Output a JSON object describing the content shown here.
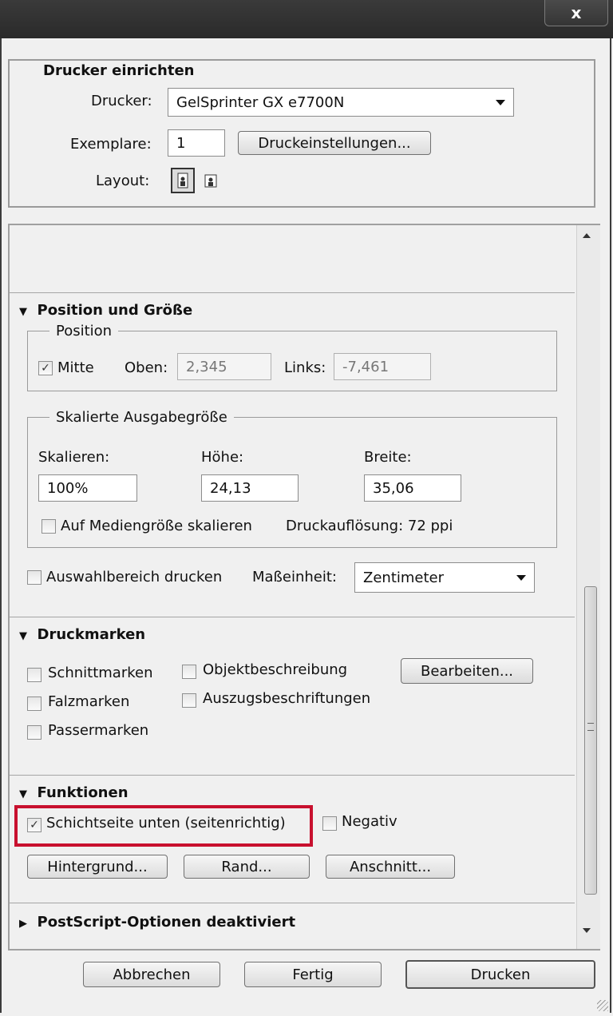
{
  "window": {
    "close_glyph": "x"
  },
  "setup": {
    "title": "Drucker einrichten",
    "printer_label": "Drucker:",
    "printer_value": "GelSprinter GX e7700N",
    "copies_label": "Exemplare:",
    "copies_value": "1",
    "settings_button": "Druckeinstellungen...",
    "layout_label": "Layout:"
  },
  "position_size": {
    "header": "Position und Größe",
    "position_group": "Position",
    "center_label": "Mitte",
    "center_checked": true,
    "top_label": "Oben:",
    "top_value": "2,345",
    "left_label": "Links:",
    "left_value": "-7,461",
    "scaled_group": "Skalierte Ausgabegröße",
    "scale_label": "Skalieren:",
    "scale_value": "100%",
    "height_label": "Höhe:",
    "height_value": "24,13",
    "width_label": "Breite:",
    "width_value": "35,06",
    "fit_media_label": "Auf Mediengröße skalieren",
    "resolution_text": "Druckauflösung: 72 ppi",
    "print_selection_label": "Auswahlbereich drucken",
    "unit_label": "Maßeinheit:",
    "unit_value": "Zentimeter"
  },
  "marks": {
    "header": "Druckmarken",
    "crop_marks": "Schnittmarken",
    "object_desc": "Objektbeschreibung",
    "edit_button": "Bearbeiten...",
    "fold_marks": "Falzmarken",
    "separation_labels": "Auszugsbeschriftungen",
    "registration_marks": "Passermarken"
  },
  "functions": {
    "header": "Funktionen",
    "emulsion_down": "Schichtseite unten (seitenrichtig)",
    "emulsion_checked": true,
    "negative": "Negativ",
    "background_button": "Hintergrund...",
    "border_button": "Rand...",
    "bleed_button": "Anschnitt..."
  },
  "postscript": {
    "header": "PostScript-Optionen deaktiviert"
  },
  "footer": {
    "cancel": "Abbrechen",
    "done": "Fertig",
    "print": "Drucken"
  },
  "colors": {
    "highlight": "#c8102e"
  }
}
